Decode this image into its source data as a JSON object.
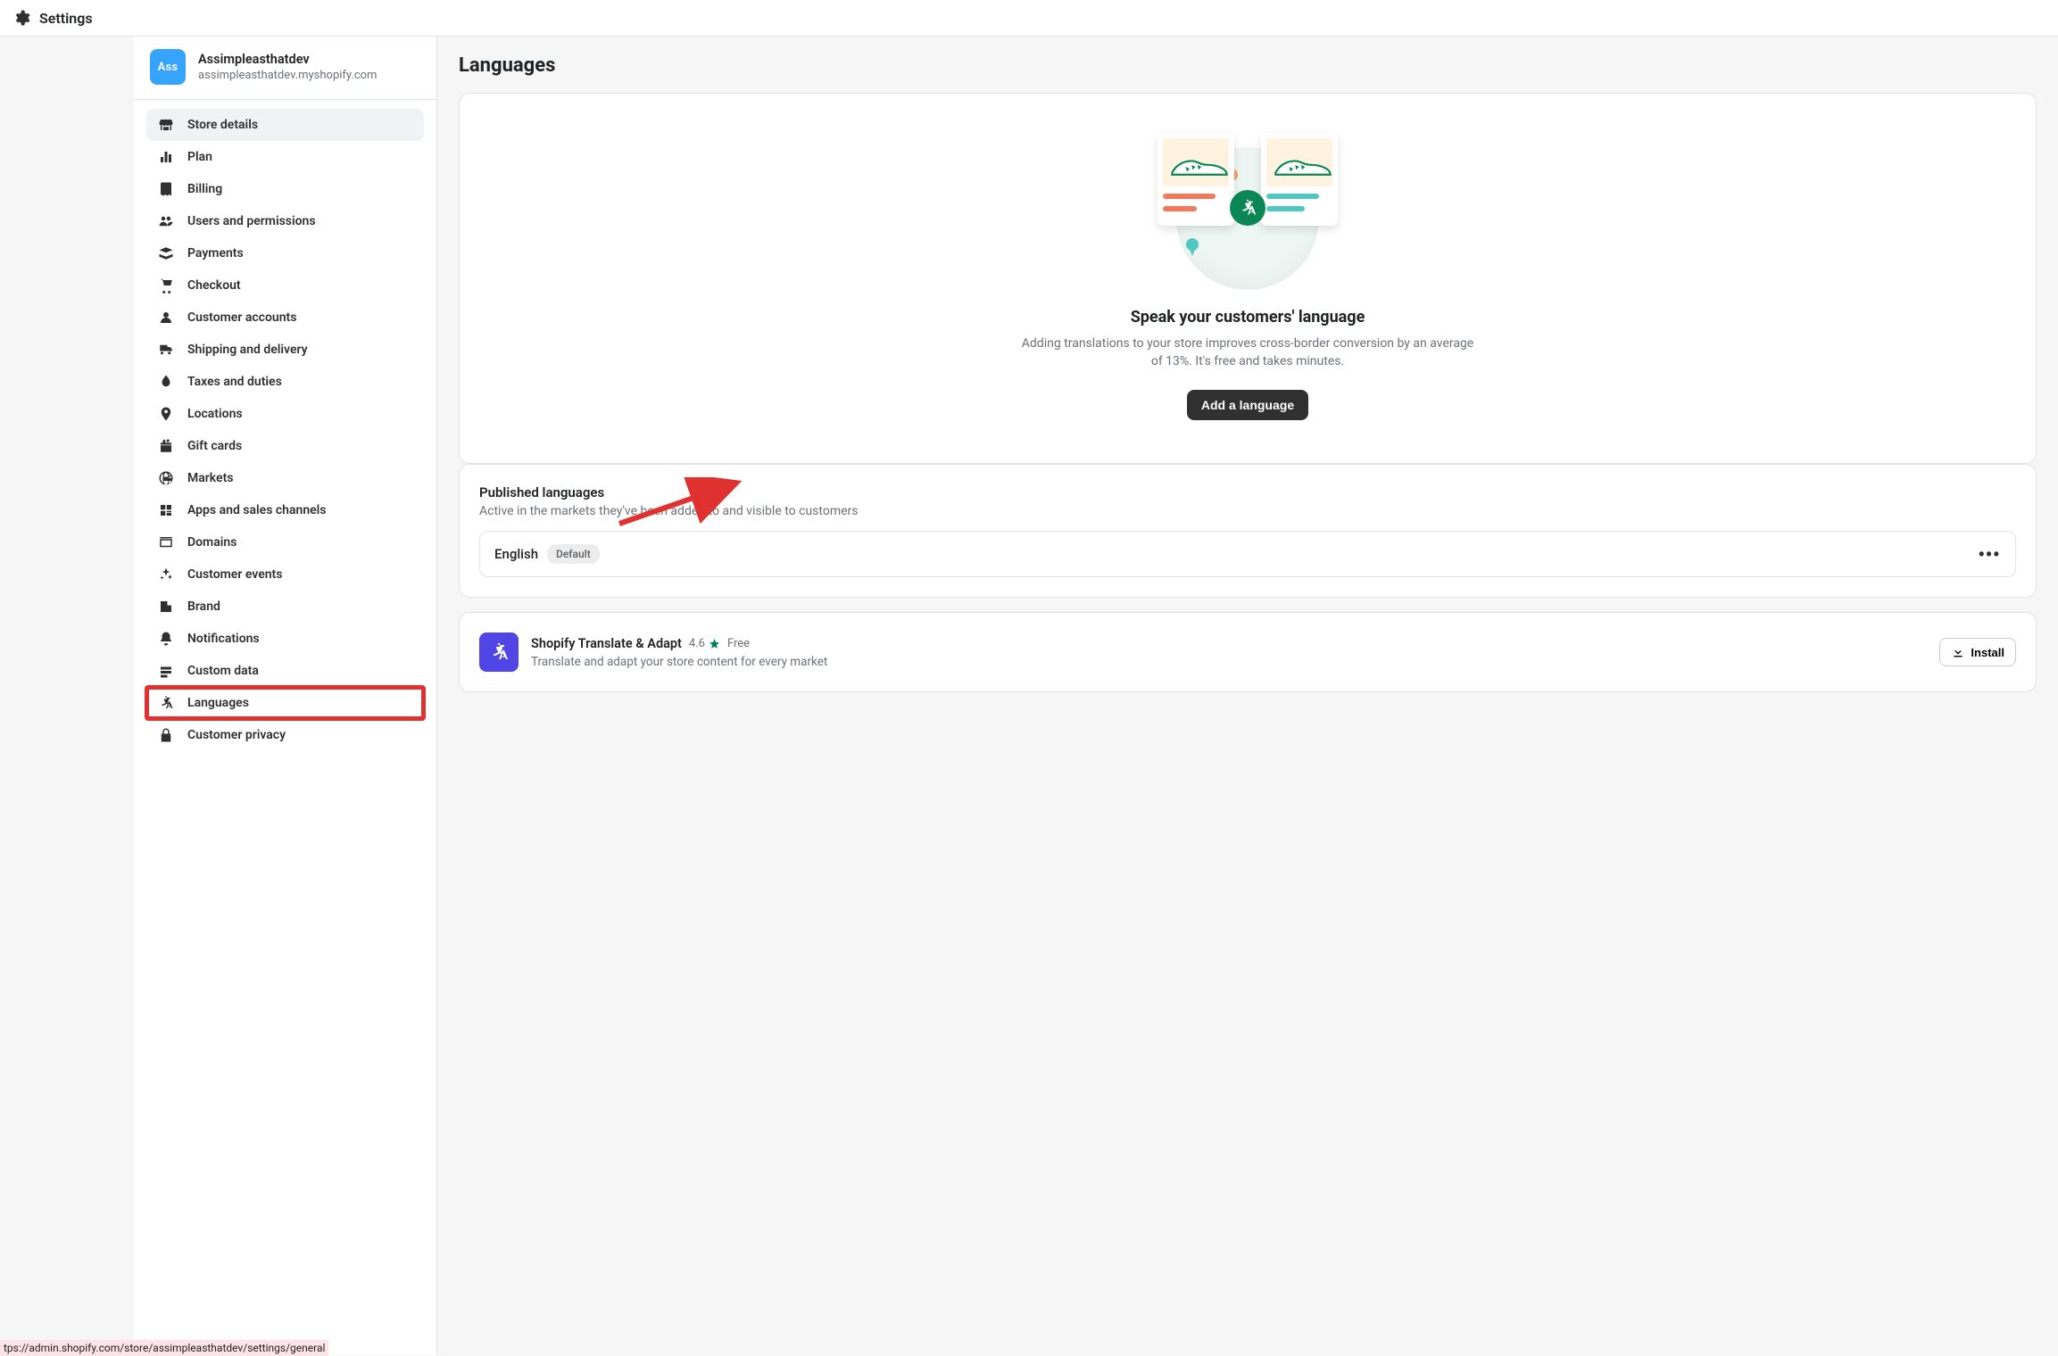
{
  "topbar": {
    "title": "Settings"
  },
  "store": {
    "avatar": "Ass",
    "name": "Assimpleasthatdev",
    "domain": "assimpleasthatdev.myshopify.com"
  },
  "sidebar": {
    "items": [
      {
        "label": "Store details",
        "icon": "storefront-icon",
        "active": true
      },
      {
        "label": "Plan",
        "icon": "plan-icon"
      },
      {
        "label": "Billing",
        "icon": "billing-icon"
      },
      {
        "label": "Users and permissions",
        "icon": "users-icon"
      },
      {
        "label": "Payments",
        "icon": "payments-icon"
      },
      {
        "label": "Checkout",
        "icon": "cart-icon"
      },
      {
        "label": "Customer accounts",
        "icon": "person-icon"
      },
      {
        "label": "Shipping and delivery",
        "icon": "truck-icon"
      },
      {
        "label": "Taxes and duties",
        "icon": "tax-icon"
      },
      {
        "label": "Locations",
        "icon": "location-icon"
      },
      {
        "label": "Gift cards",
        "icon": "giftcard-icon"
      },
      {
        "label": "Markets",
        "icon": "globe-icon"
      },
      {
        "label": "Apps and sales channels",
        "icon": "apps-icon"
      },
      {
        "label": "Domains",
        "icon": "domain-icon"
      },
      {
        "label": "Customer events",
        "icon": "spark-icon"
      },
      {
        "label": "Brand",
        "icon": "brand-icon"
      },
      {
        "label": "Notifications",
        "icon": "bell-icon"
      },
      {
        "label": "Custom data",
        "icon": "data-icon"
      },
      {
        "label": "Languages",
        "icon": "language-icon",
        "highlight": true
      },
      {
        "label": "Customer privacy",
        "icon": "lock-icon"
      }
    ]
  },
  "page": {
    "title": "Languages"
  },
  "hero": {
    "heading": "Speak your customers' language",
    "body": "Adding translations to your store improves cross-border conversion by an average of 13%. It's free and takes minutes.",
    "button": "Add a language"
  },
  "published": {
    "title": "Published languages",
    "desc": "Active in the markets they've been added to and visible to customers",
    "rows": [
      {
        "language": "English",
        "badge": "Default"
      }
    ]
  },
  "app": {
    "name": "Shopify Translate & Adapt",
    "rating": "4.6",
    "price": "Free",
    "desc": "Translate and adapt your store content for every market",
    "install": "Install"
  },
  "status_url": "tps://admin.shopify.com/store/assimpleasthatdev/settings/general"
}
